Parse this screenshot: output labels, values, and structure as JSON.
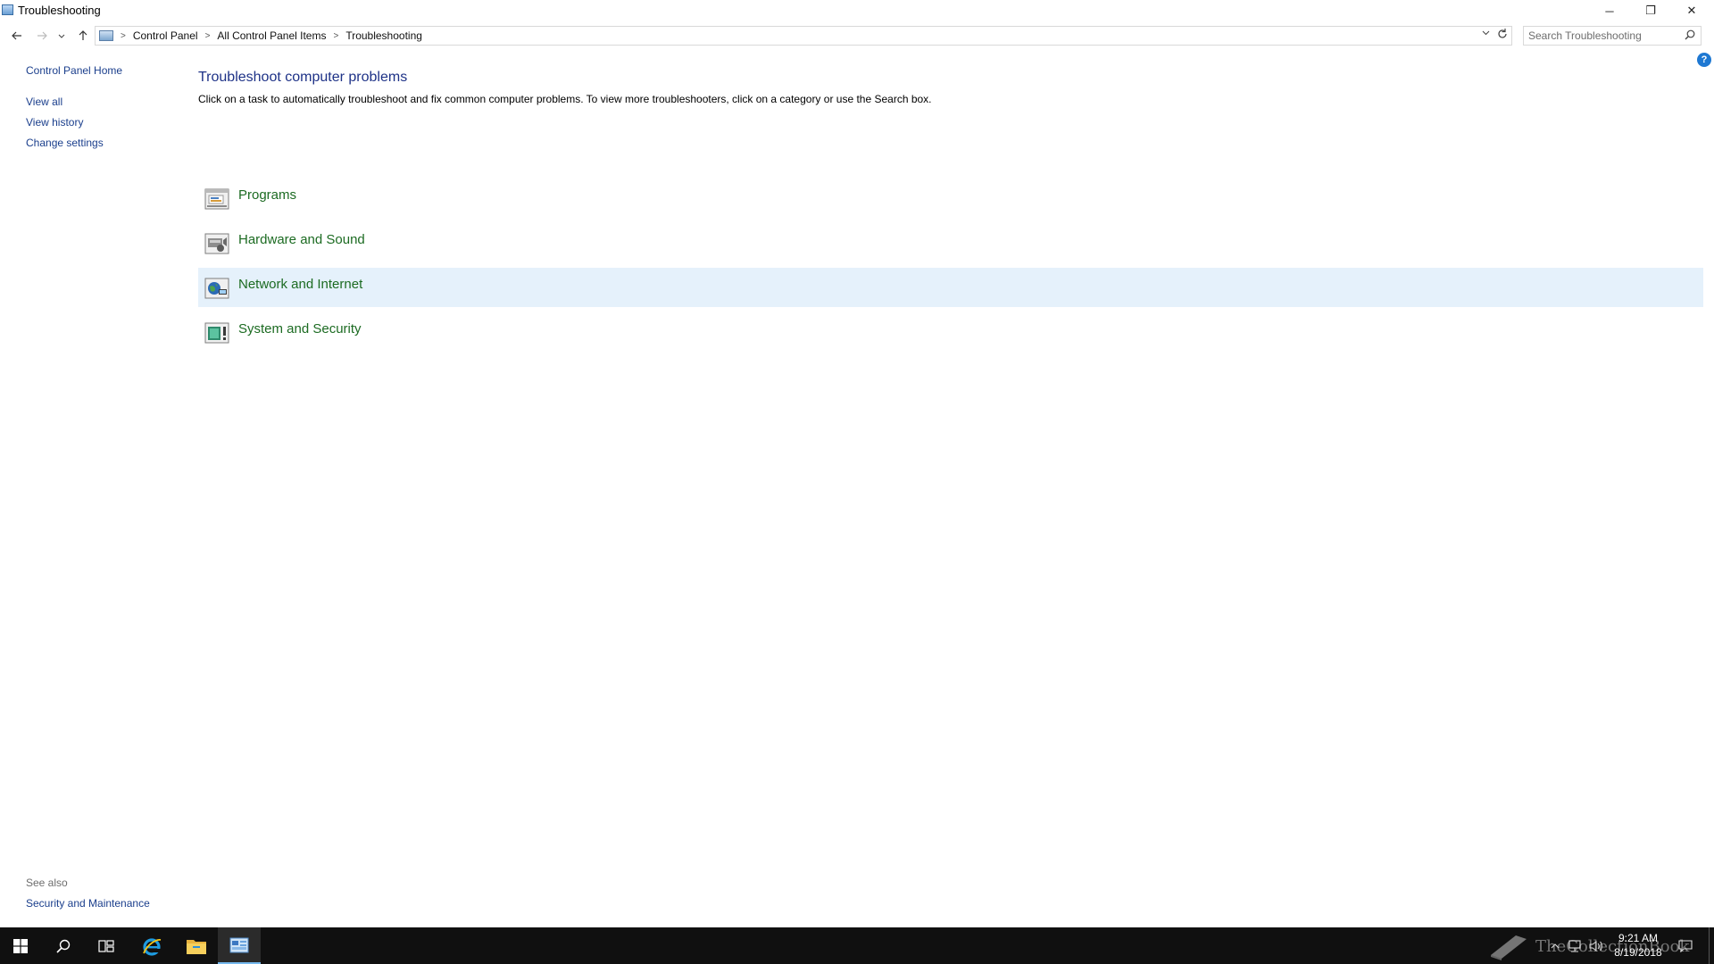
{
  "window": {
    "title": "Troubleshooting",
    "buttons": {
      "minimize": "─",
      "maximize": "❐",
      "close": "✕"
    }
  },
  "navigation": {
    "back_icon": "arrow-left-icon",
    "forward_icon": "arrow-right-icon",
    "recent_icon": "chevron-down-icon",
    "up_icon": "arrow-up-icon",
    "breadcrumb": [
      "Control Panel",
      "All Control Panel Items",
      "Troubleshooting"
    ],
    "search_placeholder": "Search Troubleshooting"
  },
  "sidebar": {
    "home": "Control Panel Home",
    "links": [
      "View all",
      "View history",
      "Change settings"
    ],
    "see_also_label": "See also",
    "see_also_links": [
      "Security and Maintenance"
    ]
  },
  "main": {
    "title": "Troubleshoot computer problems",
    "description": "Click on a task to automatically troubleshoot and fix common computer problems. To view more troubleshooters, click on a category or use the Search box.",
    "categories": [
      {
        "label": "Programs",
        "icon": "programs-icon",
        "highlighted": false
      },
      {
        "label": "Hardware and Sound",
        "icon": "hardware-sound-icon",
        "highlighted": false
      },
      {
        "label": "Network and Internet",
        "icon": "network-internet-icon",
        "highlighted": true
      },
      {
        "label": "System and Security",
        "icon": "system-security-icon",
        "highlighted": false
      }
    ],
    "help_glyph": "?"
  },
  "taskbar": {
    "pinned": [
      "windows-start-icon",
      "search-icon",
      "task-view-icon",
      "internet-explorer-icon",
      "file-explorer-icon",
      "control-panel-icon"
    ],
    "clock": {
      "time": "9:21 AM",
      "date": "8/19/2018"
    },
    "watermark": "TheCollectionBook"
  },
  "colors": {
    "link_blue": "#1a3e8c",
    "title_blue": "#1e3287",
    "category_green": "#1c6b22",
    "highlight": "#e5f1fb",
    "taskbar": "#101010",
    "taskbar_accent": "#76b9ed"
  }
}
